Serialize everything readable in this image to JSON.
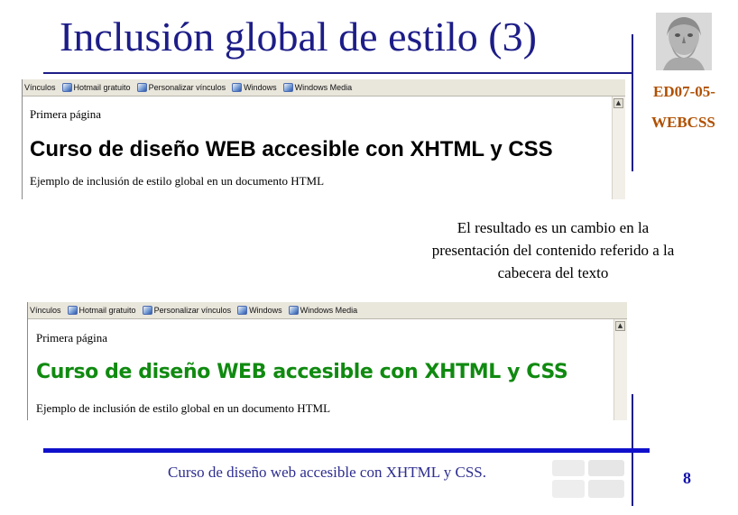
{
  "slide": {
    "title": "Inclusión global de estilo (3)",
    "code_line1": "ED07-05-",
    "code_line2": "WEBCSS",
    "description": "El resultado es un cambio en la presentación del contenido referido a la cabecera del texto",
    "footer": "Curso de diseño web accesible con XHTML y CSS.",
    "page_number": "8"
  },
  "browser_toolbar": {
    "items": [
      "Vínculos",
      "Hotmail gratuito",
      "Personalizar vínculos",
      "Windows",
      "Windows Media"
    ]
  },
  "screenshot_before": {
    "nav_text": "Primera página",
    "heading": "Curso de diseño WEB accesible con XHTML y CSS",
    "paragraph": "Ejemplo de inclusión de estilo global en un documento HTML"
  },
  "screenshot_after": {
    "nav_text": "Primera página",
    "heading": "Curso de diseño WEB accesible con XHTML y CSS",
    "paragraph": "Ejemplo de inclusión de estilo global en un documento HTML",
    "heading_color": "#108a10"
  },
  "colors": {
    "title": "#1d1d88",
    "code": "#b05000",
    "rule": "#1010cc"
  }
}
